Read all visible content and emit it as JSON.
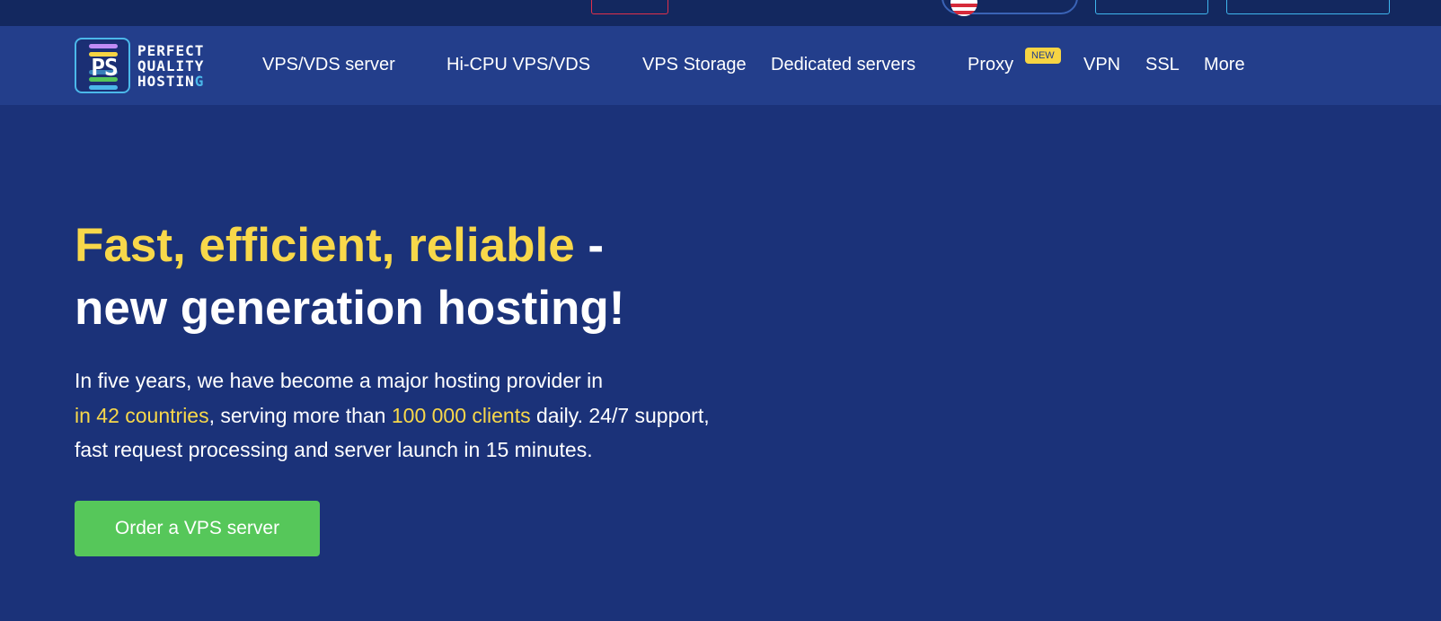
{
  "logo": {
    "mark": "PS",
    "line1": "PERFECT",
    "line2": "QUALITY",
    "line3_main": "HOSTIN",
    "line3_accent": "G",
    "bar_colors": [
      "#c08bf5",
      "#f6d443",
      "#4bb8ea",
      "#56c75a",
      "#4bb8ea"
    ]
  },
  "nav": {
    "items": [
      {
        "label": "VPS/VDS server"
      },
      {
        "label": "Hi-CPU VPS/VDS"
      },
      {
        "label": "VPS Storage"
      },
      {
        "label": "Dedicated servers"
      },
      {
        "label": "Proxy"
      },
      {
        "label": "VPN"
      },
      {
        "label": "SSL"
      },
      {
        "label": "More"
      }
    ],
    "proxy_badge": "NEW"
  },
  "hero": {
    "title_highlight": "Fast, efficient, reliable",
    "title_rest_1": " -",
    "title_line2": "new generation hosting!",
    "desc_part1": "In five years, we have become a major hosting provider in",
    "desc_highlight1": "in 42 countries",
    "desc_part2": ", serving more than ",
    "desc_highlight2": "100 000 clients",
    "desc_part3": " daily. 24/7 support,",
    "desc_part4": "fast request processing and server launch in 15 minutes.",
    "cta_label": "Order a VPS server"
  },
  "colors": {
    "background": "#1b3279",
    "nav_background": "#233e8b",
    "topbar_background": "#13285f",
    "accent_yellow": "#f8d84a",
    "cta_green": "#56c75a",
    "accent_cyan": "#4bb8ea"
  },
  "icons": {
    "language_flag": "us-flag-icon"
  }
}
